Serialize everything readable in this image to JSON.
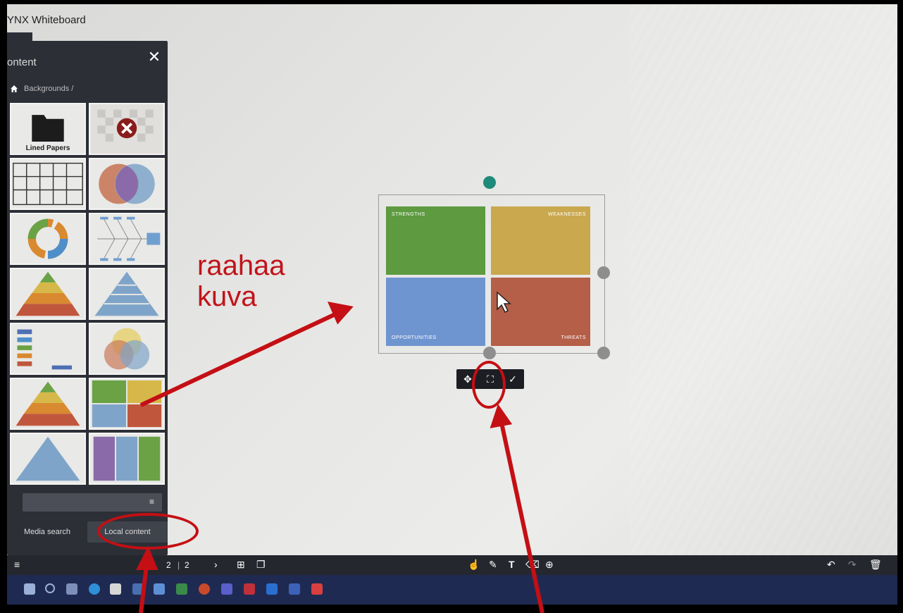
{
  "app": {
    "title": "YNX Whiteboard"
  },
  "content_panel": {
    "header": "ontent",
    "close_icon": "close-icon",
    "breadcrumb": "Backgrounds /",
    "tiles": [
      {
        "name": "lined-papers-folder",
        "label": "Lined Papers"
      },
      {
        "name": "no-background"
      },
      {
        "name": "grid-background"
      },
      {
        "name": "venn-two"
      },
      {
        "name": "cycle-arrows"
      },
      {
        "name": "fishbone"
      },
      {
        "name": "pyramid-colored"
      },
      {
        "name": "pyramid-blue"
      },
      {
        "name": "flow-arrows"
      },
      {
        "name": "venn-three"
      },
      {
        "name": "pyramid-colored-2"
      },
      {
        "name": "swot-quadrants"
      },
      {
        "name": "pyramid-blue-2"
      },
      {
        "name": "columns-three"
      }
    ],
    "tabs": {
      "media_search": "Media search",
      "local_content": "Local content"
    }
  },
  "canvas": {
    "swot": {
      "strengths": "STRENGTHS",
      "weaknesses": "WEAKNESSES",
      "opportunities": "OPPORTUNITIES",
      "threats": "THREATS"
    },
    "colors": {
      "strengths": "#5d9a40",
      "weaknesses": "#c9a84e",
      "opportunities": "#6f95d0",
      "threats": "#b55e48",
      "rotate_handle": "#1f8a7a"
    }
  },
  "bottom_bar": {
    "page_current": "2",
    "page_total": "2"
  },
  "annotations": {
    "label_line1": "raahaa",
    "label_line2": "kuva"
  }
}
